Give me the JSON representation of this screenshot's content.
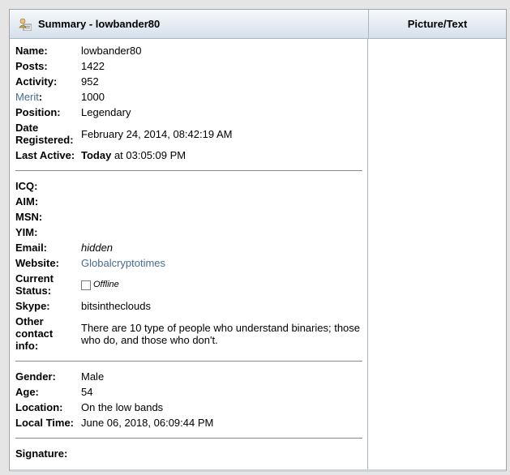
{
  "header": {
    "title": "Summary - lowbander80",
    "right_title": "Picture/Text",
    "icon": "user-profile-icon"
  },
  "profile": {
    "name_label": "Name:",
    "name": "lowbander80",
    "posts_label": "Posts:",
    "posts": "1422",
    "activity_label": "Activity:",
    "activity": "952",
    "merit_label": "Merit",
    "merit_colon": ":",
    "merit": "1000",
    "position_label": "Position:",
    "position": "Legendary",
    "date_registered_label_1": "Date",
    "date_registered_label_2": "Registered:",
    "date_registered": "February 24, 2014, 08:42:19 AM",
    "last_active_label": "Last Active:",
    "last_active_bold": "Today",
    "last_active_rest": " at 03:05:09 PM"
  },
  "contact": {
    "icq_label": "ICQ:",
    "aim_label": "AIM:",
    "msn_label": "MSN:",
    "yim_label": "YIM:",
    "email_label": "Email:",
    "email": "hidden",
    "website_label": "Website:",
    "website": "Globalcryptotimes",
    "status_label_1": "Current",
    "status_label_2": "Status:",
    "status": "Offline",
    "skype_label": "Skype:",
    "skype": "bitsintheclouds",
    "other_label_1": "Other",
    "other_label_2": "contact",
    "other_label_3": "info:",
    "other": "There are 10 type of people who understand binaries; those who do, and those who don't."
  },
  "personal": {
    "gender_label": "Gender:",
    "gender": "Male",
    "age_label": "Age:",
    "age": "54",
    "location_label": "Location:",
    "location": "On the low bands",
    "local_time_label": "Local Time:",
    "local_time": "June 06, 2018, 06:09:44 PM"
  },
  "signature": {
    "label": "Signature:"
  }
}
